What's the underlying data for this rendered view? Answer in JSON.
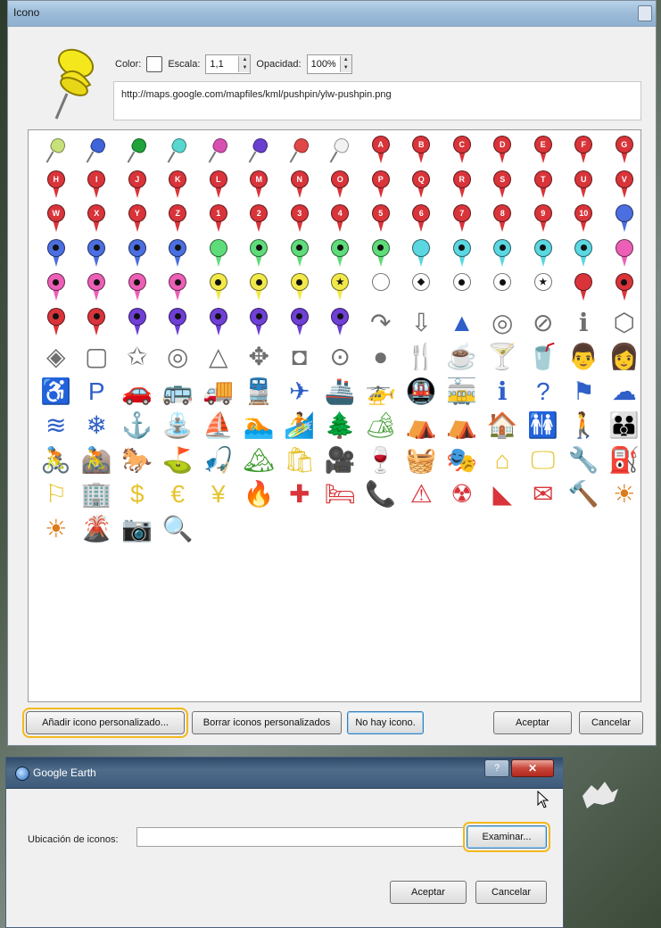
{
  "icon_dialog": {
    "title": "Icono",
    "color_label": "Color:",
    "scale_label": "Escala:",
    "scale_value": "1,1",
    "opacity_label": "Opacidad:",
    "opacity_value": "100%",
    "url": "http://maps.google.com/mapfiles/kml/pushpin/ylw-pushpin.png",
    "buttons": {
      "add_custom": "Añadir icono personalizado...",
      "delete_custom": "Borrar iconos personalizados",
      "no_icon": "No hay icono.",
      "accept": "Aceptar",
      "cancel": "Cancelar"
    }
  },
  "icon_grid": {
    "pushpins": [
      "#c8e07a",
      "#3f63d8",
      "#1fa33a",
      "#58d6d0",
      "#d84fb2",
      "#6a3fd0",
      "#e04848",
      "#f2f2f2"
    ],
    "letters_row1": [
      "A",
      "B",
      "C",
      "D",
      "E",
      "F",
      "G"
    ],
    "letters_row2": [
      "H",
      "I",
      "J",
      "K",
      "L",
      "M",
      "N",
      "O",
      "P",
      "Q",
      "R",
      "S",
      "T",
      "U",
      "V"
    ],
    "letters_row3": [
      "W",
      "X",
      "Y",
      "Z",
      "1",
      "2",
      "3",
      "4",
      "5",
      "6",
      "7",
      "8",
      "9",
      "10"
    ],
    "marker_red": "#d8343a",
    "marker_blue": "#4b6fe0",
    "marker_green": "#5fdc7a",
    "marker_cyan": "#5ad7e0",
    "marker_pink": "#ec5fb6",
    "marker_yellow": "#f1e84a",
    "marker_white": "#ffffff",
    "marker_purple": "#6f3fd6",
    "symbol_icons": [
      "↷",
      "⇩",
      "▲",
      "◎",
      "⊘",
      "ℹ",
      "⬡",
      "◈",
      "▢",
      "✩",
      "◎",
      "△",
      "✥",
      "◘",
      "⊙",
      "●",
      "🍴",
      "☕",
      "🍸",
      "🥤",
      "👨",
      "👩",
      "♿",
      "P",
      "🚗",
      "🚌",
      "🚚",
      "🚆",
      "✈",
      "🚢",
      "🚁",
      "🚇",
      "🚋",
      "ℹ",
      "?",
      "⚑",
      "☁",
      "≋",
      "❄",
      "⚓",
      "⛲",
      "⛵",
      "🏊",
      "🏄",
      "🌲",
      "🏕",
      "⛺",
      "⛺",
      "🏠",
      "🚻",
      "🚶",
      "👪",
      "🚴",
      "🚵",
      "🐎",
      "⛳",
      "🎣",
      "🏔",
      "🛍",
      "🎥",
      "🍷",
      "🧺",
      "🎭",
      "⌂",
      "🖵",
      "🔧",
      "⛽",
      "⚐",
      "🏢",
      "$",
      "€",
      "¥",
      "🔥",
      "✚",
      "🛏",
      "📞",
      "⚠",
      "☢",
      "◣",
      "✉",
      "🔨",
      "☀",
      "☀",
      "🌋",
      "📷",
      "🔍"
    ],
    "symbol_colors": {
      "outline": "#6f6f6f",
      "blue": "#2f5fc8",
      "green": "#3a9a2a",
      "yellow": "#e6c432",
      "red": "#d8343a",
      "orange": "#e07a18"
    }
  },
  "ge_dialog": {
    "title": "Google Earth",
    "help": "?",
    "close": "✕",
    "location_label": "Ubicación de iconos:",
    "browse": "Examinar...",
    "accept": "Aceptar",
    "cancel": "Cancelar"
  }
}
